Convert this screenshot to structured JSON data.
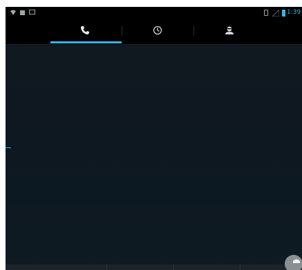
{
  "status_bar": {
    "time": "1:39",
    "icons": [
      "wifi-icon",
      "notification-icon",
      "image-icon",
      "vibrate-icon",
      "signal-icon",
      "battery-icon"
    ]
  },
  "tabs": [
    {
      "name": "phone",
      "icon": "phone-icon",
      "selected": true
    },
    {
      "name": "history",
      "icon": "clock-icon",
      "selected": false
    },
    {
      "name": "contacts",
      "icon": "contact-icon",
      "selected": false
    }
  ],
  "colors": {
    "accent": "#33b5e5",
    "background": "#0f1820",
    "bar": "#000000"
  }
}
